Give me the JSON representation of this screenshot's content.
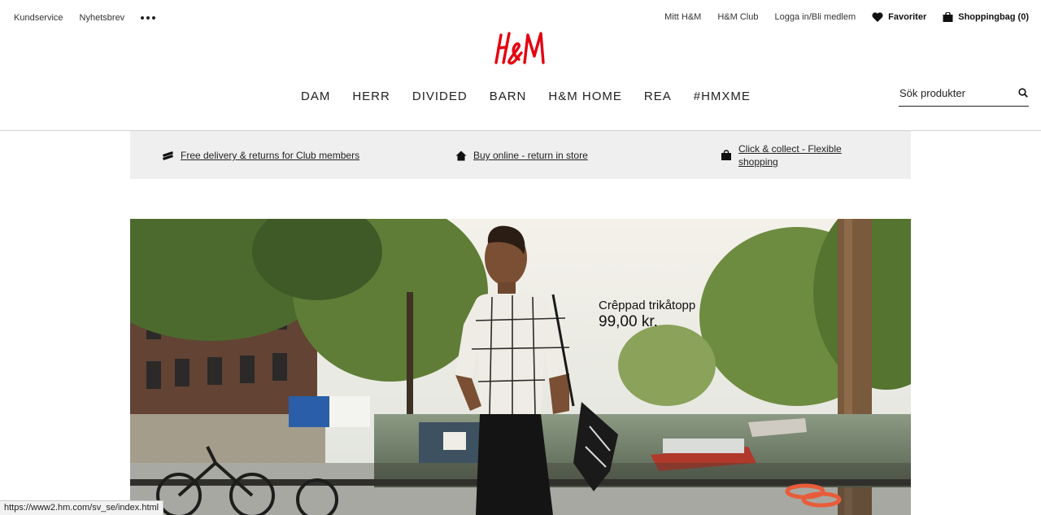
{
  "topbar": {
    "left": [
      "Kundservice",
      "Nyhetsbrev"
    ],
    "more_icon": "more-dots-icon",
    "right": [
      "Mitt H&M",
      "H&M Club",
      "Logga in/Bli medlem"
    ],
    "favorites": "Favoriter",
    "bag": "Shoppingbag (0)"
  },
  "logo": {
    "text": "H&M",
    "color": "#e50010"
  },
  "nav": [
    "DAM",
    "HERR",
    "DIVIDED",
    "BARN",
    "H&M HOME",
    "REA",
    "#HMXME"
  ],
  "search": {
    "placeholder": "Sök produkter",
    "icon": "search-icon"
  },
  "usp": [
    {
      "text": "Free delivery & returns for Club members",
      "icon": "card-icon"
    },
    {
      "text": "Buy online - return in store",
      "icon": "home-icon"
    },
    {
      "text": "Click & collect - Flexible shopping",
      "icon": "bag-icon"
    }
  ],
  "hero": {
    "product_name": "Crêppad trikåtopp",
    "price": "99,00 kr."
  },
  "status_url": "https://www2.hm.com/sv_se/index.html"
}
